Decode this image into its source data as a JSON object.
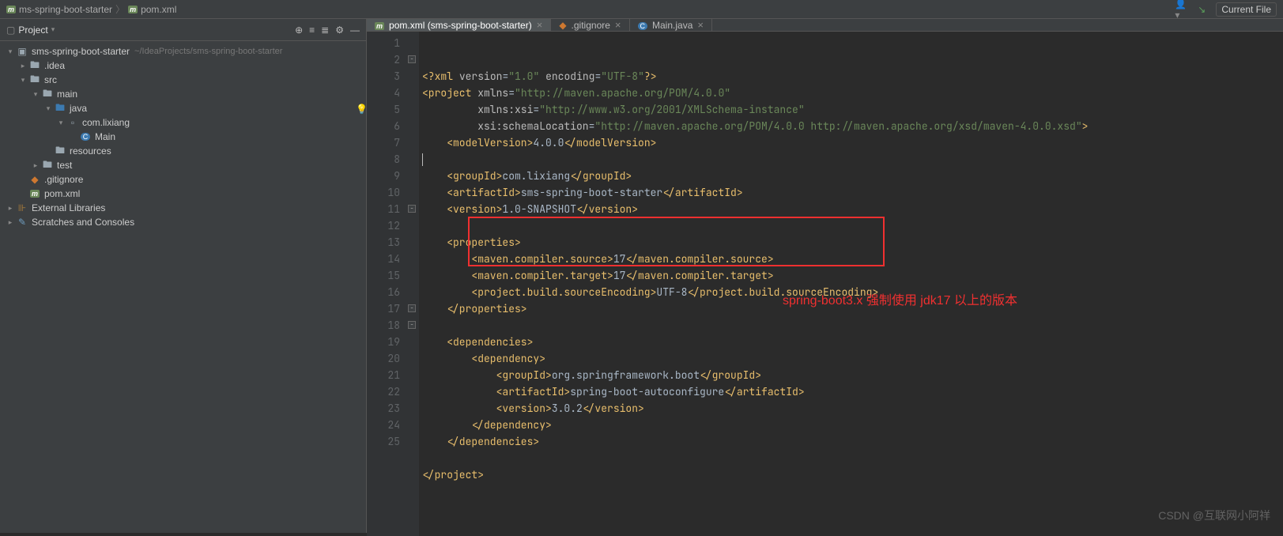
{
  "header": {
    "crumb1": "ms-spring-boot-starter",
    "crumb2": "pom.xml",
    "current_file": "Current File"
  },
  "sidebar": {
    "title": "Project",
    "tree": [
      {
        "indent": 0,
        "arrow": "expanded",
        "icon": "module",
        "label": "sms-spring-boot-starter",
        "hint": "~/IdeaProjects/sms-spring-boot-starter"
      },
      {
        "indent": 1,
        "arrow": "collapsed",
        "icon": "folder",
        "label": ".idea"
      },
      {
        "indent": 1,
        "arrow": "expanded",
        "icon": "folder",
        "label": "src"
      },
      {
        "indent": 2,
        "arrow": "expanded",
        "icon": "folder",
        "label": "main"
      },
      {
        "indent": 3,
        "arrow": "expanded",
        "icon": "folder-src",
        "label": "java"
      },
      {
        "indent": 4,
        "arrow": "expanded",
        "icon": "package",
        "label": "com.lixiang"
      },
      {
        "indent": 5,
        "arrow": "none",
        "icon": "class",
        "label": "Main"
      },
      {
        "indent": 3,
        "arrow": "none",
        "icon": "folder-res",
        "label": "resources"
      },
      {
        "indent": 2,
        "arrow": "collapsed",
        "icon": "folder",
        "label": "test"
      },
      {
        "indent": 1,
        "arrow": "none",
        "icon": "gitignore",
        "label": ".gitignore"
      },
      {
        "indent": 1,
        "arrow": "none",
        "icon": "maven",
        "label": "pom.xml"
      },
      {
        "indent": 0,
        "arrow": "collapsed",
        "icon": "lib",
        "label": "External Libraries"
      },
      {
        "indent": 0,
        "arrow": "collapsed",
        "icon": "scratch",
        "label": "Scratches and Consoles"
      }
    ]
  },
  "tabs": [
    {
      "icon": "maven",
      "label": "pom.xml (sms-spring-boot-starter)",
      "active": true
    },
    {
      "icon": "gitignore",
      "label": ".gitignore",
      "active": false
    },
    {
      "icon": "class",
      "label": "Main.java",
      "active": false
    }
  ],
  "code": {
    "lines": [
      {
        "n": 1,
        "html": "<span class='t-pi'>&lt;?xml</span> <span class='t-attr'>version</span><span class='t-txt'>=</span><span class='t-str'>\"1.0\"</span> <span class='t-attr'>encoding</span><span class='t-txt'>=</span><span class='t-str'>\"UTF-8\"</span><span class='t-pi'>?&gt;</span>"
      },
      {
        "n": 2,
        "html": "<span class='t-tag'>&lt;project</span> <span class='t-attr'>xmlns</span><span class='t-txt'>=</span><span class='t-str'>\"http://maven.apache.org/POM/4.0.0\"</span>"
      },
      {
        "n": 3,
        "html": "         <span class='t-attr'>xmlns:xsi</span><span class='t-txt'>=</span><span class='t-str'>\"http://www.w3.org/2001/XMLSchema-instance\"</span>"
      },
      {
        "n": 4,
        "html": "         <span class='t-attr'>xsi:schemaLocation</span><span class='t-txt'>=</span><span class='t-str'>\"http://maven.apache.org/POM/4.0.0 http://maven.apache.org/xsd/maven-4.0.0.xsd\"</span><span class='t-tag'>&gt;</span>"
      },
      {
        "n": 5,
        "html": "    <span class='t-tag'>&lt;modelVersion&gt;</span><span class='t-txt'>4.0.0</span><span class='t-tag'>&lt;/modelVersion&gt;</span>",
        "bulb": true
      },
      {
        "n": 6,
        "html": ""
      },
      {
        "n": 7,
        "html": "    <span class='t-tag'>&lt;groupId&gt;</span><span class='t-txt'>com.lixiang</span><span class='t-tag'>&lt;/groupId&gt;</span>"
      },
      {
        "n": 8,
        "html": "    <span class='t-tag'>&lt;artifactId&gt;</span><span class='t-txt'>sms-spring-boot-starter</span><span class='t-tag'>&lt;/artifactId&gt;</span>"
      },
      {
        "n": 9,
        "html": "    <span class='t-tag'>&lt;version&gt;</span><span class='t-txt'>1.0-SNAPSHOT</span><span class='t-tag'>&lt;/version&gt;</span>"
      },
      {
        "n": 10,
        "html": ""
      },
      {
        "n": 11,
        "html": "    <span class='t-tag'>&lt;properties&gt;</span>"
      },
      {
        "n": 12,
        "html": "        <span class='t-tag'>&lt;maven.compiler.source&gt;</span><span class='t-txt'>17</span><span class='t-tag'>&lt;/maven.compiler.source&gt;</span>"
      },
      {
        "n": 13,
        "html": "        <span class='t-tag'>&lt;maven.compiler.target&gt;</span><span class='t-txt'>17</span><span class='t-tag'>&lt;/maven.compiler.target&gt;</span>"
      },
      {
        "n": 14,
        "html": "        <span class='t-tag'>&lt;project.build.sourceEncoding&gt;</span><span class='t-txt'>UTF-8</span><span class='t-tag'>&lt;/project.build.sourceEncoding&gt;</span>"
      },
      {
        "n": 15,
        "html": "    <span class='t-tag'>&lt;/properties&gt;</span>"
      },
      {
        "n": 16,
        "html": ""
      },
      {
        "n": 17,
        "html": "    <span class='t-tag'>&lt;dependencies&gt;</span>"
      },
      {
        "n": 18,
        "html": "        <span class='t-tag'>&lt;dependency&gt;</span>"
      },
      {
        "n": 19,
        "html": "            <span class='t-tag'>&lt;groupId&gt;</span><span class='t-txt'>org.springframework.boot</span><span class='t-tag'>&lt;/groupId&gt;</span>"
      },
      {
        "n": 20,
        "html": "            <span class='t-tag'>&lt;artifactId&gt;</span><span class='t-txt'>spring-boot-autoconfigure</span><span class='t-tag'>&lt;/artifactId&gt;</span>"
      },
      {
        "n": 21,
        "html": "            <span class='t-tag'>&lt;version&gt;</span><span class='t-txt'>3.0.2</span><span class='t-tag'>&lt;/version&gt;</span>"
      },
      {
        "n": 22,
        "html": "        <span class='t-tag'>&lt;/dependency&gt;</span>"
      },
      {
        "n": 23,
        "html": "    <span class='t-tag'>&lt;/dependencies&gt;</span>"
      },
      {
        "n": 24,
        "html": ""
      },
      {
        "n": 25,
        "html": "<span class='t-tag'>&lt;/project&gt;</span>"
      }
    ]
  },
  "annotation": "spring-boot3.x 强制使用 jdk17 以上的版本",
  "watermark": "CSDN @互联网小阿祥"
}
